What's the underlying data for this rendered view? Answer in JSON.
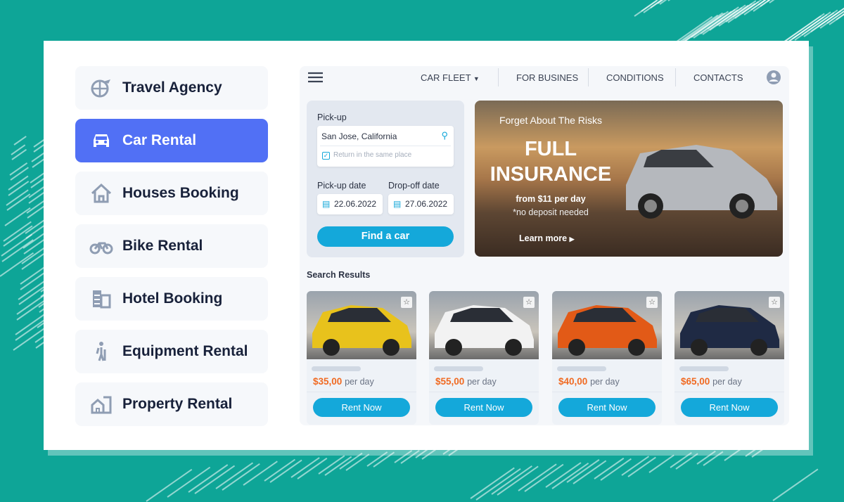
{
  "sidebar": {
    "items": [
      {
        "label": "Travel Agency",
        "icon": "globe-plane-icon",
        "active": false
      },
      {
        "label": "Car Rental",
        "icon": "car-icon",
        "active": true
      },
      {
        "label": "Houses Booking",
        "icon": "house-icon",
        "active": false
      },
      {
        "label": "Bike Rental",
        "icon": "bike-icon",
        "active": false
      },
      {
        "label": "Hotel Booking",
        "icon": "building-icon",
        "active": false
      },
      {
        "label": "Equipment Rental",
        "icon": "hiker-icon",
        "active": false
      },
      {
        "label": "Property Rental",
        "icon": "property-icon",
        "active": false
      }
    ]
  },
  "nav": {
    "car_fleet": "CAR FLEET",
    "for_business": "FOR BUSINES",
    "conditions": "CONDITIONS",
    "contacts": "CONTACTS"
  },
  "search": {
    "pickup_label": "Pick-up",
    "pickup_value": "San Jose, California",
    "return_same": "Return in the same place",
    "pickup_date_label": "Pick-up date",
    "dropoff_date_label": "Drop-off date",
    "pickup_date": "22.06.2022",
    "dropoff_date": "27.06.2022",
    "find_button": "Find a car"
  },
  "banner": {
    "kicker": "Forget About The Risks",
    "title_line1": "FULL",
    "title_line2": "INSURANCE",
    "price": "from $11 per day",
    "note": "*no deposit needed",
    "cta": "Learn more"
  },
  "results": {
    "title": "Search Results",
    "per_day": "per day",
    "rent_label": "Rent Now",
    "cars": [
      {
        "price": "$35,00",
        "color": "#e8c21c"
      },
      {
        "price": "$55,00",
        "color": "#f2f2f2"
      },
      {
        "price": "$40,00",
        "color": "#e25a17"
      },
      {
        "price": "$65,00",
        "color": "#1f2a44"
      }
    ]
  },
  "colors": {
    "accent": "#5170f5",
    "button": "#14a8da",
    "price": "#f06a22",
    "background": "#0ea597"
  }
}
